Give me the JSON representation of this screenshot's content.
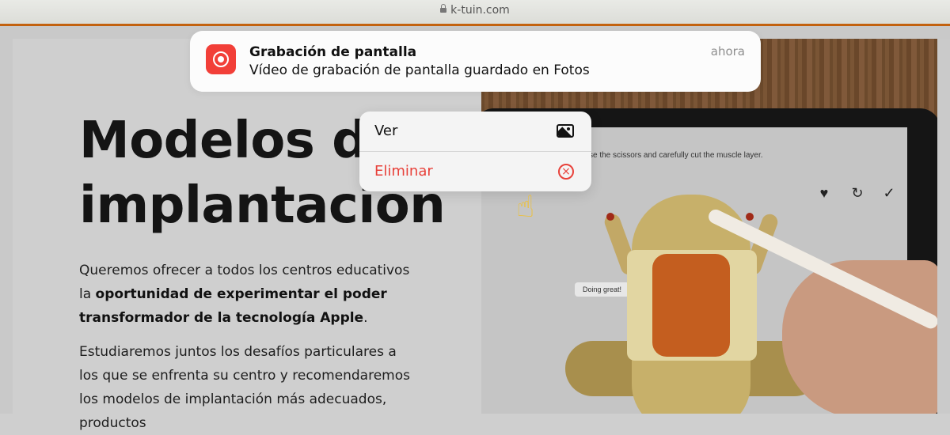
{
  "browser": {
    "url": "k-tuin.com"
  },
  "page": {
    "title_line1": "Modelos de",
    "title_line2": "implantación",
    "p1_text1": "Queremos ofrecer a todos los centros educativos la ",
    "p1_bold": "oportunidad de experimentar el poder transformador de la tecnología Apple",
    "p1_text2": ".",
    "p2_text": "Estudiaremos juntos los desafíos particulares a los que se enfrenta su centro y recomendaremos los modelos de implantación más adecuados, productos"
  },
  "photo": {
    "instruction": "se the scissors and carefully cut the muscle layer.",
    "bubble": "Doing great!",
    "tools": [
      "heart-icon",
      "rotate-icon",
      "check-icon"
    ]
  },
  "notification": {
    "app_icon": "screen-record-icon",
    "title": "Grabación de pantalla",
    "body": "Vídeo de grabación de pantalla guardado en Fotos",
    "time": "ahora"
  },
  "context_menu": {
    "items": [
      {
        "label": "Ver",
        "icon": "photo-icon"
      },
      {
        "label": "Eliminar",
        "icon": "x-circle-icon"
      }
    ]
  },
  "cursor": {
    "icon": "pointing-hand-icon",
    "glyph": "☝"
  },
  "colors": {
    "accent_orange": "#c3620f",
    "destructive_red": "#e8413a",
    "record_red": "#f23f38"
  }
}
